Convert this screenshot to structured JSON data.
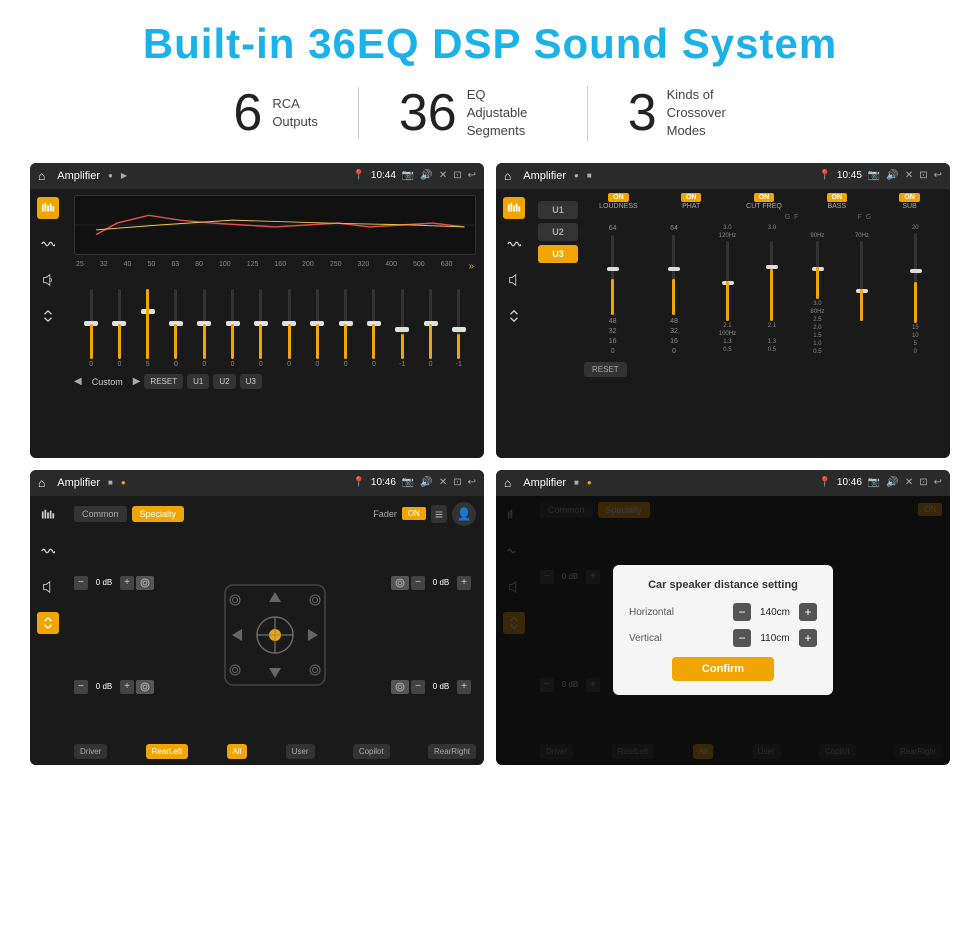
{
  "header": {
    "title": "Built-in 36EQ DSP Sound System"
  },
  "stats": [
    {
      "number": "6",
      "line1": "RCA",
      "line2": "Outputs"
    },
    {
      "number": "36",
      "line1": "EQ Adjustable",
      "line2": "Segments"
    },
    {
      "number": "3",
      "line1": "Kinds of",
      "line2": "Crossover Modes"
    }
  ],
  "screen1": {
    "app": "Amplifier",
    "time": "10:44",
    "eq_labels": [
      "25",
      "32",
      "40",
      "50",
      "63",
      "80",
      "100",
      "125",
      "160",
      "200",
      "250",
      "320",
      "400",
      "500",
      "630"
    ],
    "eq_values": [
      "0",
      "0",
      "5",
      "0",
      "0",
      "0",
      "0",
      "0",
      "0",
      "0",
      "0",
      "-1",
      "0",
      "-1"
    ],
    "eq_heights": [
      35,
      35,
      55,
      35,
      35,
      35,
      35,
      35,
      35,
      35,
      35,
      25,
      35,
      25
    ],
    "buttons": [
      "RESET",
      "U1",
      "U2",
      "U3"
    ],
    "custom_label": "Custom"
  },
  "screen2": {
    "app": "Amplifier",
    "time": "10:45",
    "u_buttons": [
      "U1",
      "U2",
      "U3"
    ],
    "modules": [
      "LOUDNESS",
      "PHAT",
      "CUT FREQ",
      "BASS",
      "SUB"
    ],
    "reset_label": "RESET"
  },
  "screen3": {
    "app": "Amplifier",
    "time": "10:46",
    "tabs": [
      "Common",
      "Specialty"
    ],
    "active_tab": "Specialty",
    "fader_label": "Fader",
    "fader_on": "ON",
    "db_rows": [
      {
        "val": "0 dB"
      },
      {
        "val": "0 dB"
      },
      {
        "val": "0 dB"
      },
      {
        "val": "0 dB"
      }
    ],
    "bottom_buttons": [
      "Driver",
      "RearLeft",
      "All",
      "User",
      "Copilot",
      "RearRight"
    ]
  },
  "screen4": {
    "app": "Amplifier",
    "time": "10:46",
    "tabs": [
      "Common",
      "Specialty"
    ],
    "dialog": {
      "title": "Car speaker distance setting",
      "horizontal_label": "Horizontal",
      "horizontal_val": "140cm",
      "vertical_label": "Vertical",
      "vertical_val": "110cm",
      "confirm_label": "Confirm"
    },
    "bottom_buttons": [
      "Driver",
      "RearLeft",
      "All",
      "User",
      "Copilot",
      "RearRight"
    ]
  }
}
